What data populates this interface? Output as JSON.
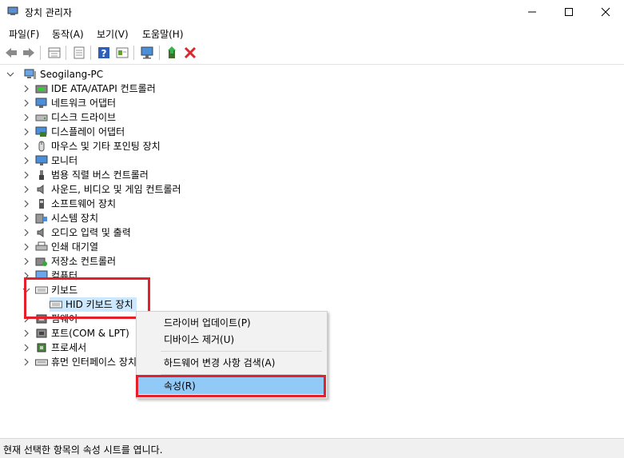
{
  "window": {
    "title": "장치 관리자"
  },
  "menu": [
    {
      "label": "파일(F)"
    },
    {
      "label": "동작(A)"
    },
    {
      "label": "보기(V)"
    },
    {
      "label": "도움말(H)"
    }
  ],
  "toolbar": {
    "icons": [
      "back-arrow-icon",
      "forward-arrow-icon",
      "device-view-icon",
      "properties-sheet-icon",
      "help-icon",
      "show-hidden-icon",
      "monitor-scan-icon",
      "update-driver-icon",
      "uninstall-x-icon"
    ]
  },
  "tree": {
    "root": "Seogilang-PC",
    "categories": [
      {
        "label": "IDE ATA/ATAPI 컨트롤러",
        "icon": "ide-controller-icon"
      },
      {
        "label": "네트워크 어댑터",
        "icon": "network-adapter-icon"
      },
      {
        "label": "디스크 드라이브",
        "icon": "disk-drive-icon"
      },
      {
        "label": "디스플레이 어댑터",
        "icon": "display-adapter-icon"
      },
      {
        "label": "마우스 및 기타 포인팅 장치",
        "icon": "mouse-icon"
      },
      {
        "label": "모니터",
        "icon": "monitor-icon"
      },
      {
        "label": "범용 직렬 버스 컨트롤러",
        "icon": "usb-icon"
      },
      {
        "label": "사운드, 비디오 및 게임 컨트롤러",
        "icon": "speaker-icon"
      },
      {
        "label": "소프트웨어 장치",
        "icon": "software-device-icon"
      },
      {
        "label": "시스템 장치",
        "icon": "system-device-icon"
      },
      {
        "label": "오디오 입력 및 출력",
        "icon": "audio-icon"
      },
      {
        "label": "인쇄 대기열",
        "icon": "printer-icon"
      },
      {
        "label": "저장소 컨트롤러",
        "icon": "storage-controller-icon"
      },
      {
        "label": "컴퓨터",
        "icon": "computer-icon"
      }
    ],
    "keyboard": {
      "label": "키보드",
      "child": "HID 키보드 장치"
    },
    "after": [
      {
        "label": "펌웨어",
        "icon": "firmware-icon"
      },
      {
        "label": "포트(COM & LPT)",
        "icon": "port-icon"
      },
      {
        "label": "프로세서",
        "icon": "processor-icon"
      },
      {
        "label": "휴먼 인터페이스 장치",
        "icon": "hid-icon"
      }
    ]
  },
  "context_menu": {
    "update_driver": "드라이버 업데이트(P)",
    "uninstall": "디바이스 제거(U)",
    "scan": "하드웨어 변경 사항 검색(A)",
    "properties": "속성(R)"
  },
  "status": "현재 선택한 항목의 속성 시트를 엽니다.",
  "colors": {
    "highlight": "#91c9f7",
    "selection": "#cce8ff",
    "annotation_red": "#e4202a"
  }
}
